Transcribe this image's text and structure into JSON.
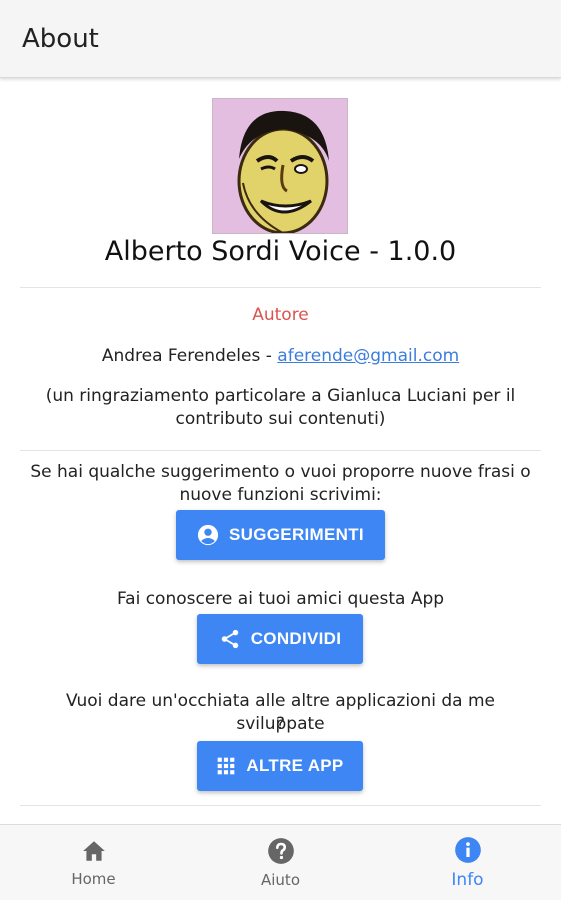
{
  "appbar": {
    "title": "About"
  },
  "app": {
    "name_version": "Alberto Sordi Voice - 1.0.0"
  },
  "author": {
    "label": "Autore",
    "name": "Andrea Ferendeles - ",
    "email": "aferende@gmail.com",
    "thanks_line1": "(un ringraziamento particolare a Gianluca Luciani per il",
    "thanks_line2": "contributo sui contenuti)"
  },
  "suggestions": {
    "text_line1": "Se hai qualche suggerimento o vuoi proporre nuove frasi o",
    "text_line2": "nuove funzioni scrivimi:",
    "button_label": "SUGGERIMENTI",
    "button_icon": "account-circle-icon"
  },
  "share": {
    "text": "Fai conoscere ai tuoi amici questa App",
    "button_label": "CONDIVIDI",
    "button_icon": "share-icon"
  },
  "other_apps": {
    "text_line1": "Vuoi dare un'occhiata alle altre applicazioni da me sviluppate",
    "text_line2": "?",
    "button_label": "ALTRE APP",
    "button_icon": "apps-grid-icon"
  },
  "bottom_nav": {
    "items": [
      {
        "label": "Home",
        "icon": "home-icon",
        "active": false
      },
      {
        "label": "Aiuto",
        "icon": "help-icon",
        "active": false
      },
      {
        "label": "Info",
        "icon": "info-icon",
        "active": true
      }
    ]
  },
  "colors": {
    "accent": "#3d86f4",
    "author_label": "#d9534f",
    "link": "#3b7ddd",
    "appbar_bg": "#f5f5f5"
  }
}
